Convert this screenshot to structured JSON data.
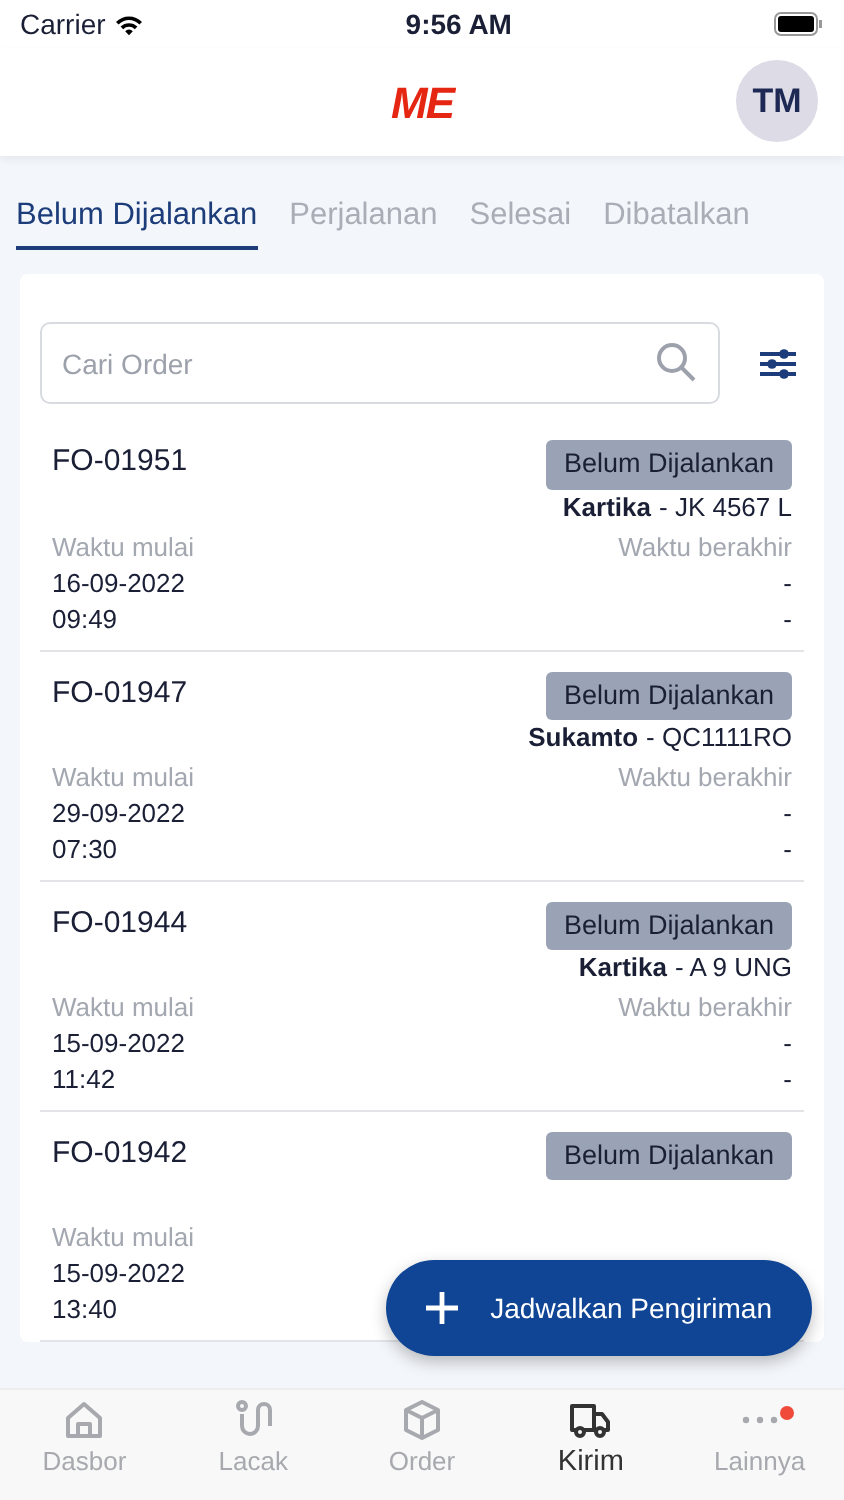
{
  "status_bar": {
    "carrier": "Carrier",
    "time": "9:56 AM"
  },
  "header": {
    "logo": "ME",
    "avatar": "TM"
  },
  "tabs": [
    {
      "label": "Belum Dijalankan",
      "selected": true
    },
    {
      "label": "Perjalanan",
      "selected": false
    },
    {
      "label": "Selesai",
      "selected": false
    },
    {
      "label": "Dibatalkan",
      "selected": false
    }
  ],
  "search": {
    "placeholder": "Cari Order"
  },
  "orders": [
    {
      "id": "FO-01951",
      "status": "Belum Dijalankan",
      "driver": "Kartika",
      "plate": "- JK 4567 L",
      "start_label": "Waktu mulai",
      "start_date": "16-09-2022",
      "start_time": "09:49",
      "end_label": "Waktu berakhir",
      "end_date": "-",
      "end_time": "-"
    },
    {
      "id": "FO-01947",
      "status": "Belum Dijalankan",
      "driver": "Sukamto",
      "plate": "- QC1111RO",
      "start_label": "Waktu mulai",
      "start_date": "29-09-2022",
      "start_time": "07:30",
      "end_label": "Waktu berakhir",
      "end_date": "-",
      "end_time": "-"
    },
    {
      "id": "FO-01944",
      "status": "Belum Dijalankan",
      "driver": "Kartika",
      "plate": "- A 9 UNG",
      "start_label": "Waktu mulai",
      "start_date": "15-09-2022",
      "start_time": "11:42",
      "end_label": "Waktu berakhir",
      "end_date": "-",
      "end_time": "-"
    },
    {
      "id": "FO-01942",
      "status": "Belum Dijalankan",
      "start_label": "Waktu mulai",
      "start_date": "15-09-2022",
      "start_time": "13:40"
    }
  ],
  "fab": {
    "label": "Jadwalkan Pengiriman"
  },
  "tab_bar": [
    {
      "label": "Dasbor",
      "kind": "home",
      "selected": false
    },
    {
      "label": "Lacak",
      "kind": "track",
      "selected": false
    },
    {
      "label": "Order",
      "kind": "box",
      "selected": false
    },
    {
      "label": "Kirim",
      "kind": "truck",
      "selected": true
    },
    {
      "label": "Lainnya",
      "kind": "more",
      "selected": false,
      "notification": true
    }
  ]
}
